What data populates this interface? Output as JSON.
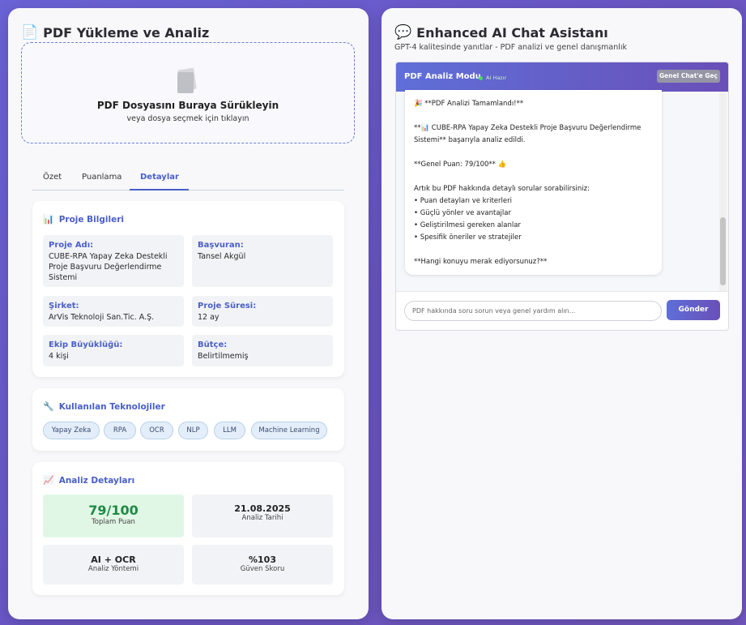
{
  "left_panel": {
    "title": "PDF Yükleme ve Analiz",
    "title_icon": "document-icon",
    "upload": {
      "main_text": "PDF Dosyasını Buraya Sürükleyin",
      "sub_text": "veya dosya seçmek için tıklayın"
    },
    "tabs": [
      {
        "label": "Özet",
        "active": false
      },
      {
        "label": "Puanlama",
        "active": false
      },
      {
        "label": "Detaylar",
        "active": true
      }
    ],
    "project_info": {
      "title": "Proje Bilgileri",
      "icon": "bar-chart-icon",
      "fields": [
        {
          "label": "Proje Adı:",
          "value": "CUBE-RPA Yapay Zeka Destekli Proje Başvuru Değerlendirme Sistemi"
        },
        {
          "label": "Başvuran:",
          "value": "Tansel Akgül"
        },
        {
          "label": "Şirket:",
          "value": "ArVis Teknoloji San.Tic. A.Ş."
        },
        {
          "label": "Proje Süresi:",
          "value": "12 ay"
        },
        {
          "label": "Ekip Büyüklüğü:",
          "value": "4 kişi"
        },
        {
          "label": "Bütçe:",
          "value": "Belirtilmemiş"
        }
      ]
    },
    "technologies": {
      "title": "Kullanılan Teknolojiler",
      "icon": "wrench-icon",
      "tags": [
        "Yapay Zeka",
        "RPA",
        "OCR",
        "NLP",
        "LLM",
        "Machine Learning"
      ]
    },
    "analysis": {
      "title": "Analiz Detayları",
      "icon": "trend-chart-icon",
      "cells": [
        {
          "value": "79/100",
          "label": "Toplam Puan"
        },
        {
          "value": "21.08.2025",
          "label": "Analiz Tarihi"
        },
        {
          "value": "AI + OCR",
          "label": "Analiz Yöntemi"
        },
        {
          "value": "%103",
          "label": "Güven Skoru"
        }
      ]
    }
  },
  "right_panel": {
    "title": "Enhanced AI Chat Asistanı",
    "title_icon": "speech-bubble-icon",
    "subtitle": "GPT-4 kalitesinde yanıtlar - PDF analizi ve genel danışmanlık",
    "chat": {
      "mode_label": "PDF Analiz Modu",
      "status_label": "AI Hazır",
      "switch_button": "Genel Chat'e Geç",
      "message_lines": [
        "🎉 **PDF Analizi Tamamlandı!**",
        "",
        "**📊 CUBE-RPA Yapay Zeka Destekli Proje Başvuru Değerlendirme Sistemi** başarıyla analiz edildi.",
        "",
        "**Genel Puan: 79/100** 👍",
        "",
        "Artık bu PDF hakkında detaylı sorular sorabilirsiniz:",
        "• Puan detayları ve kriterleri",
        "• Güçlü yönler ve avantajlar",
        "• Geliştirilmesi gereken alanlar",
        "• Spesifik öneriler ve stratejiler",
        "",
        "**Hangi konuyu merak ediyorsunuz?**"
      ],
      "input_placeholder": "PDF hakkında soru sorun veya genel yardım alın...",
      "send_label": "Gönder"
    }
  },
  "colors": {
    "accent": "#4a5fc8",
    "background_gradient_start": "#6a63d6",
    "score_green": "#1f8a44",
    "status_dot": "#4cd964"
  }
}
